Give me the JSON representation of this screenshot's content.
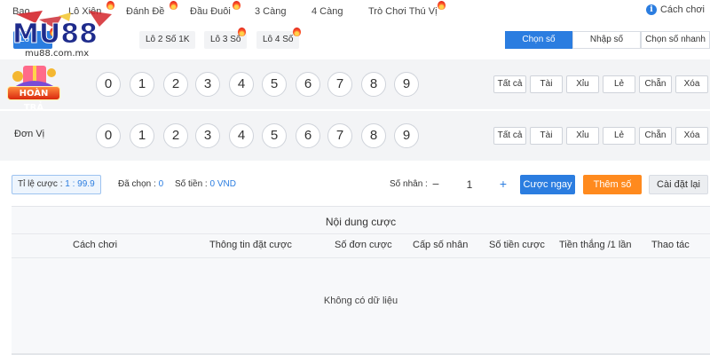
{
  "nav": {
    "items": [
      {
        "label": "Bao"
      },
      {
        "label": "Lô Xiên"
      },
      {
        "label": "Đánh Đề"
      },
      {
        "label": "Đầu Đuôi"
      },
      {
        "label": "3 Càng"
      },
      {
        "label": "4 Càng"
      },
      {
        "label": "Trò Chơi Thú Vị"
      }
    ],
    "howto": "Cách chơi"
  },
  "subtabs": [
    {
      "label": "Lô 2"
    },
    {
      "label": "Lô 2 Số 1K"
    },
    {
      "label": "Lô 3 Số"
    },
    {
      "label": "Lô 4 Số"
    }
  ],
  "modes": [
    {
      "label": "Chọn số"
    },
    {
      "label": "Nhập số"
    },
    {
      "label": "Chọn số nhanh"
    }
  ],
  "rows": [
    {
      "label": ""
    },
    {
      "label": "Đơn Vị"
    }
  ],
  "numbers": [
    "0",
    "1",
    "2",
    "3",
    "4",
    "5",
    "6",
    "7",
    "8",
    "9"
  ],
  "quick": [
    "Tất cả",
    "Tài",
    "Xỉu",
    "Lẻ",
    "Chẵn",
    "Xóa"
  ],
  "betbar": {
    "ratio_label": "Tỉ lệ cược :",
    "ratio_value": "1 : 99.9",
    "chosen_label": "Đã chọn :",
    "chosen_value": "0",
    "amount_label": "Số tiền :",
    "amount_value": "0 VND",
    "multiplier_label": "Số nhân :",
    "multiplier_value": "1",
    "minus": "−",
    "plus": "+",
    "bet_now": "Cược ngay",
    "add_number": "Thêm số",
    "reset": "Cài đặt lại"
  },
  "table": {
    "title": "Nội dung cược",
    "columns": [
      "Cách chơi",
      "Thông tin đặt cược",
      "Số đơn cược",
      "Cấp số nhân",
      "Số tiền cược",
      "Tiền thắng /1 lần",
      "Thao tác"
    ],
    "empty": "Không có dữ liệu"
  },
  "brand": {
    "logo_text": "MU88",
    "site": "mu88.com.mx",
    "promo": "HOÀN TRẢ"
  },
  "colors": {
    "accent": "#2b7de0",
    "orange": "#ff8a1e",
    "row_bg": "#f3f4f6"
  }
}
